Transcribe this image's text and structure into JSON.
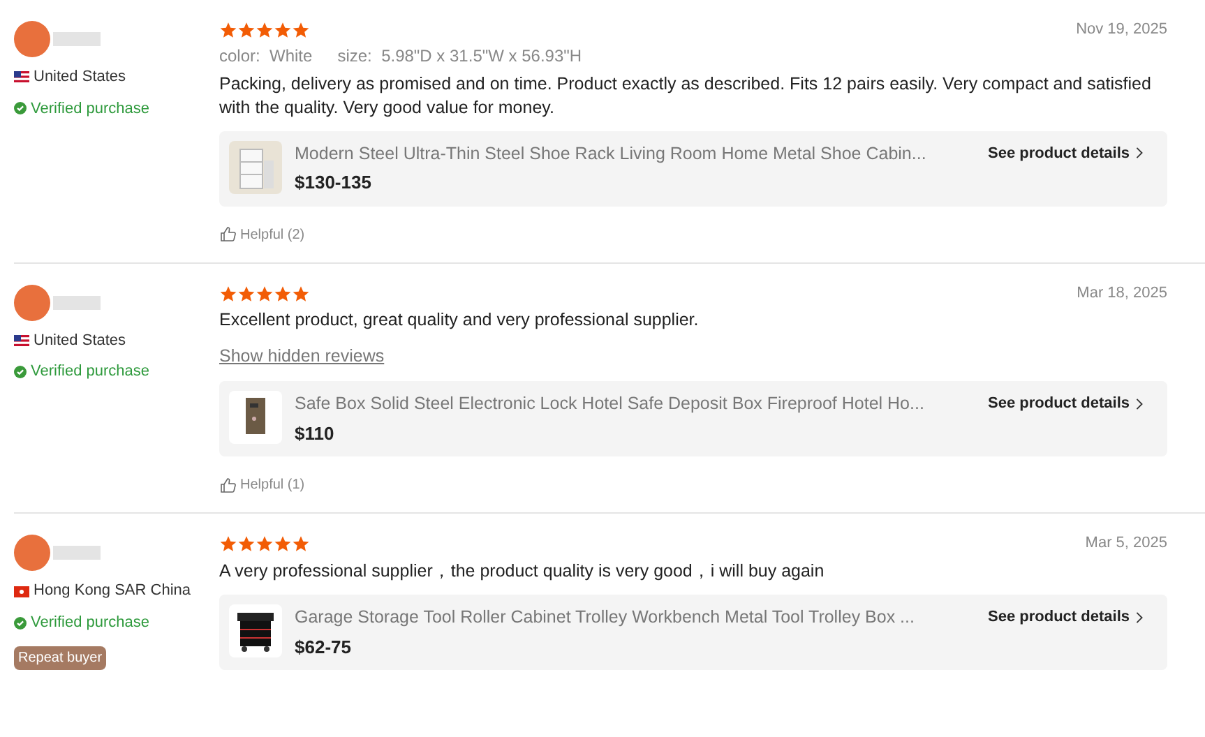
{
  "reviews": [
    {
      "country": "United States",
      "flag": {
        "kind": "us"
      },
      "verified": "Verified purchase",
      "stars": 5,
      "date": "Nov 19, 2025",
      "attributes": [
        {
          "label": "color:",
          "value": "White"
        },
        {
          "label": "size:",
          "value": "5.98\"D x 31.5\"W x 56.93\"H"
        }
      ],
      "text": "Packing, delivery as promised and on time. Product exactly as described. Fits 12 pairs easily. Very compact and satisfied with the quality. Very good value for money.",
      "product": {
        "kind": "shoe-rack",
        "title": "Modern Steel Ultra-Thin Steel Shoe Rack Living Room Home Metal Shoe Cabin...",
        "price": "$130-135",
        "link": "See product details"
      },
      "helpful": "Helpful (2)"
    },
    {
      "country": "United States",
      "flag": {
        "kind": "us"
      },
      "verified": "Verified purchase",
      "stars": 5,
      "date": "Mar 18, 2025",
      "text": "Excellent product, great quality and very professional supplier.",
      "hidden_link": "Show hidden reviews",
      "product": {
        "kind": "safe",
        "title": "Safe Box Solid Steel Electronic Lock Hotel Safe Deposit Box Fireproof Hotel Ho...",
        "price": "$110",
        "link": "See product details"
      },
      "helpful": "Helpful (1)"
    },
    {
      "country": "Hong Kong SAR China",
      "flag": {
        "kind": "hk"
      },
      "verified": "Verified purchase",
      "repeat_buyer": "Repeat buyer",
      "stars": 5,
      "date": "Mar 5, 2025",
      "text": "A very professional supplier，the product quality is very good，i will buy again",
      "product": {
        "kind": "tool-cabinet",
        "title": "Garage Storage Tool Roller Cabinet Trolley Workbench Metal Tool Trolley Box ...",
        "price": "$62-75",
        "link": "See product details"
      }
    }
  ]
}
